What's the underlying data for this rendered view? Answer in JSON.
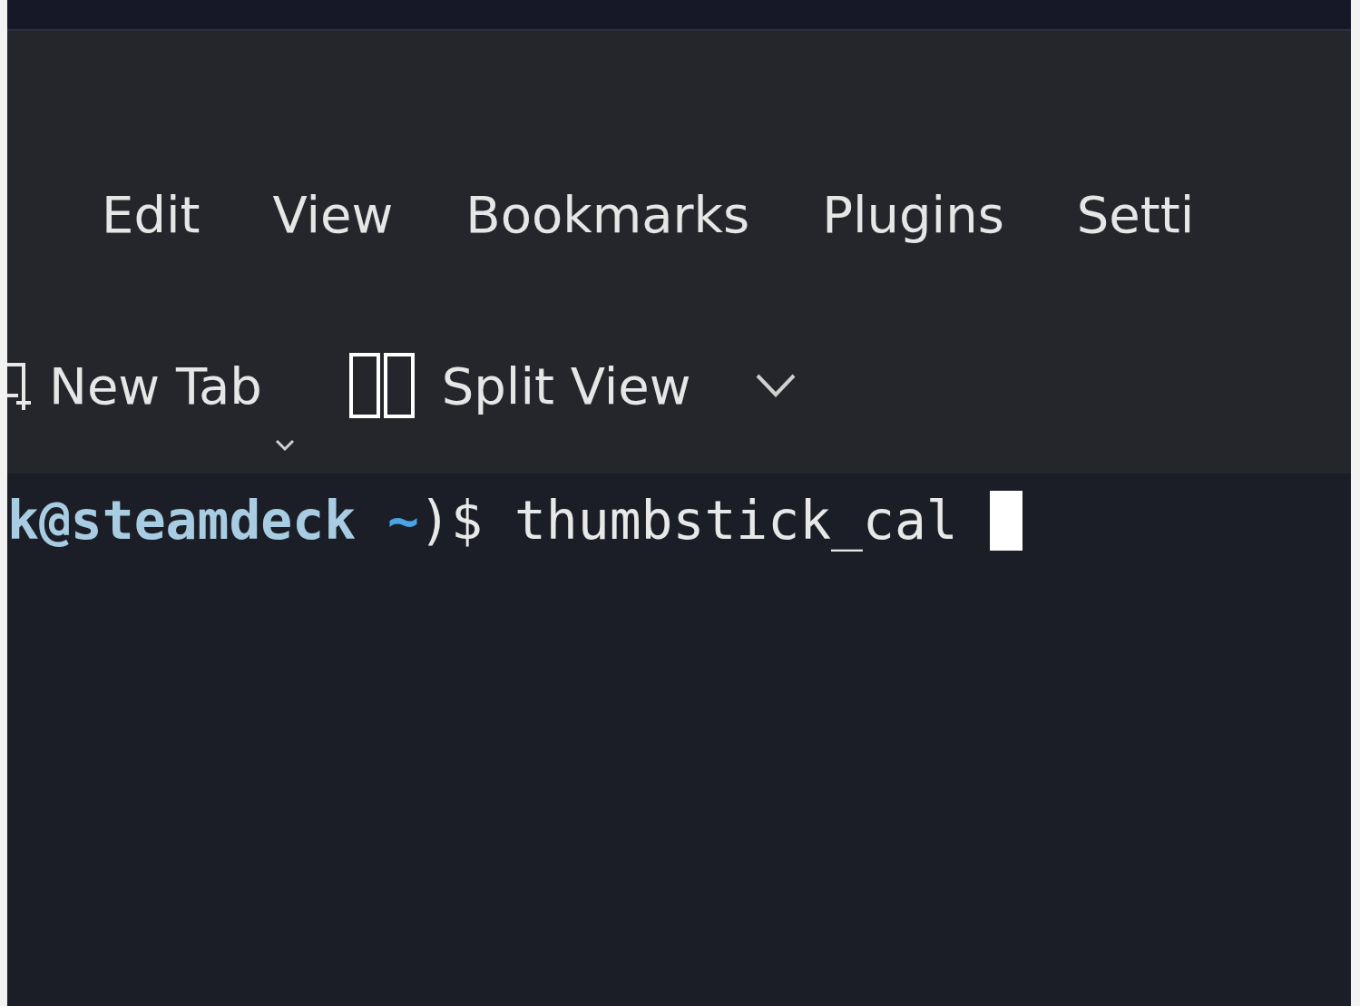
{
  "menu_bar": {
    "items": [
      {
        "label": "Edit"
      },
      {
        "label": "View"
      },
      {
        "label": "Bookmarks"
      },
      {
        "label": "Plugins"
      },
      {
        "label": "Setti"
      }
    ]
  },
  "toolbar": {
    "buttons": [
      {
        "kind": "new_tab",
        "label": "New Tab"
      },
      {
        "kind": "split_view",
        "label": "Split View"
      }
    ]
  },
  "terminal": {
    "lines": [
      {
        "user_host": "k@steamdeck",
        "path": "~",
        "prompt_end": ")$",
        "command": "thumbstick_cal",
        "cursor": true
      }
    ]
  }
}
